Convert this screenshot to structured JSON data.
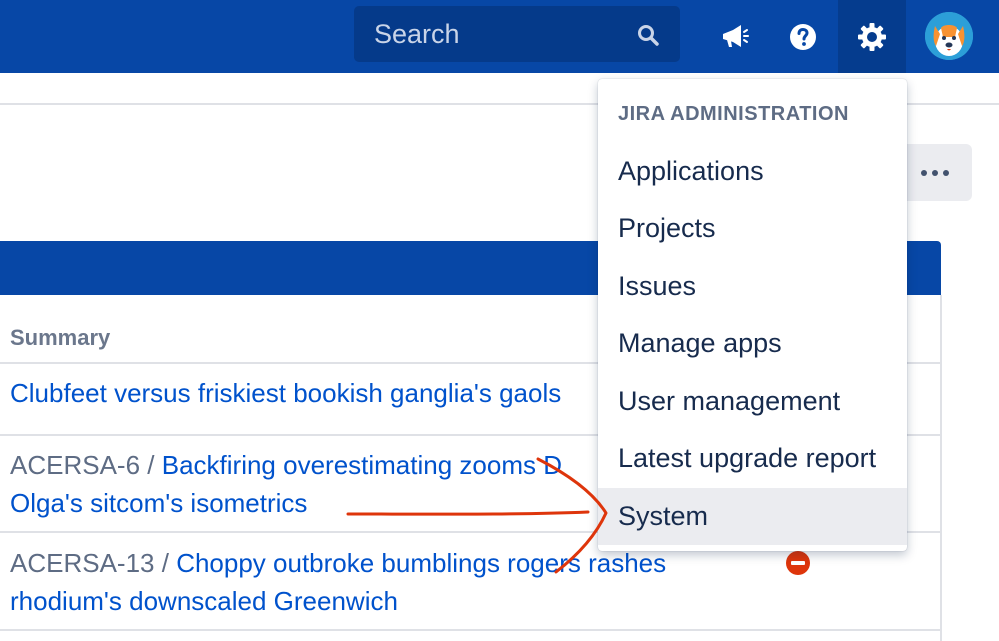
{
  "header": {
    "search_placeholder": "Search",
    "icons": [
      "search-icon",
      "megaphone-icon",
      "help-icon",
      "gear-icon",
      "avatar"
    ],
    "brand_color": "#0747a6"
  },
  "issues_table": {
    "column_summary": "Summary",
    "rows": [
      {
        "key": "",
        "summary_line1": "Clubfeet versus friskiest bookish ganglia's gaols"
      },
      {
        "key": "ACERSA-6 /",
        "summary_line1": "Backfiring overestimating zooms D",
        "summary_line2": "Olga's sitcom's isometrics"
      },
      {
        "key": "ACERSA-13 /",
        "summary_line1": "Choppy outbroke bumblings rogers rashes",
        "summary_line2": "rhodium's downscaled Greenwich",
        "priority_icon": "blocker-icon"
      }
    ]
  },
  "admin_menu": {
    "heading": "JIRA ADMINISTRATION",
    "items": [
      {
        "label": "Applications"
      },
      {
        "label": "Projects"
      },
      {
        "label": "Issues"
      },
      {
        "label": "Manage apps"
      },
      {
        "label": "User management"
      },
      {
        "label": "Latest upgrade report"
      },
      {
        "label": "System",
        "state": "hovered"
      }
    ]
  },
  "annotation": {
    "color": "#de350b",
    "shape": "curved arrow pointing to System"
  }
}
